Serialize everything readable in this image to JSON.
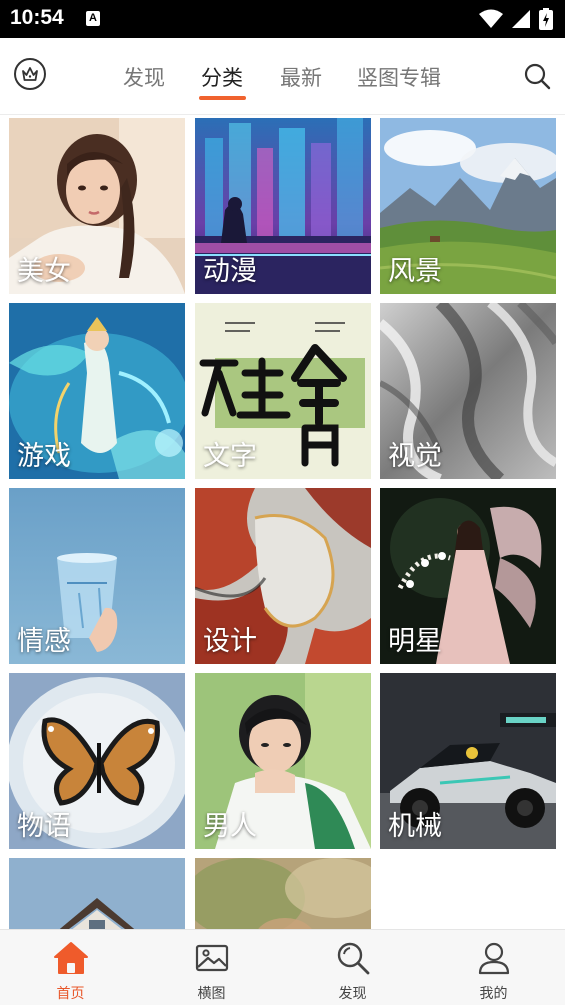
{
  "status_bar": {
    "time": "10:54",
    "notification_glyph": "A"
  },
  "top_bar": {
    "tabs": [
      {
        "label": "发现",
        "active": false
      },
      {
        "label": "分类",
        "active": true
      },
      {
        "label": "最新",
        "active": false
      },
      {
        "label": "竖图专辑",
        "active": false
      }
    ],
    "accent": "#f0622e"
  },
  "categories": [
    {
      "label": "美女",
      "icon": "portrait-girl-image"
    },
    {
      "label": "动漫",
      "icon": "anime-city-image"
    },
    {
      "label": "风景",
      "icon": "mountain-landscape-image"
    },
    {
      "label": "游戏",
      "icon": "game-fantasy-image"
    },
    {
      "label": "文字",
      "icon": "calligraphy-image"
    },
    {
      "label": "视觉",
      "icon": "abstract-silver-image"
    },
    {
      "label": "情感",
      "icon": "glass-cup-image"
    },
    {
      "label": "设计",
      "icon": "marble-design-image"
    },
    {
      "label": "明星",
      "icon": "star-fairy-image"
    },
    {
      "label": "物语",
      "icon": "butterfly-image"
    },
    {
      "label": "男人",
      "icon": "boy-portrait-image"
    },
    {
      "label": "机械",
      "icon": "race-car-image"
    },
    {
      "label": "",
      "icon": "house-roof-image"
    },
    {
      "label": "",
      "icon": "blurred-outdoor-image"
    }
  ],
  "bottom_nav": [
    {
      "label": "首页",
      "icon": "home-icon",
      "active": true
    },
    {
      "label": "横图",
      "icon": "image-icon",
      "active": false
    },
    {
      "label": "发现",
      "icon": "search-icon",
      "active": false
    },
    {
      "label": "我的",
      "icon": "user-icon",
      "active": false
    }
  ]
}
